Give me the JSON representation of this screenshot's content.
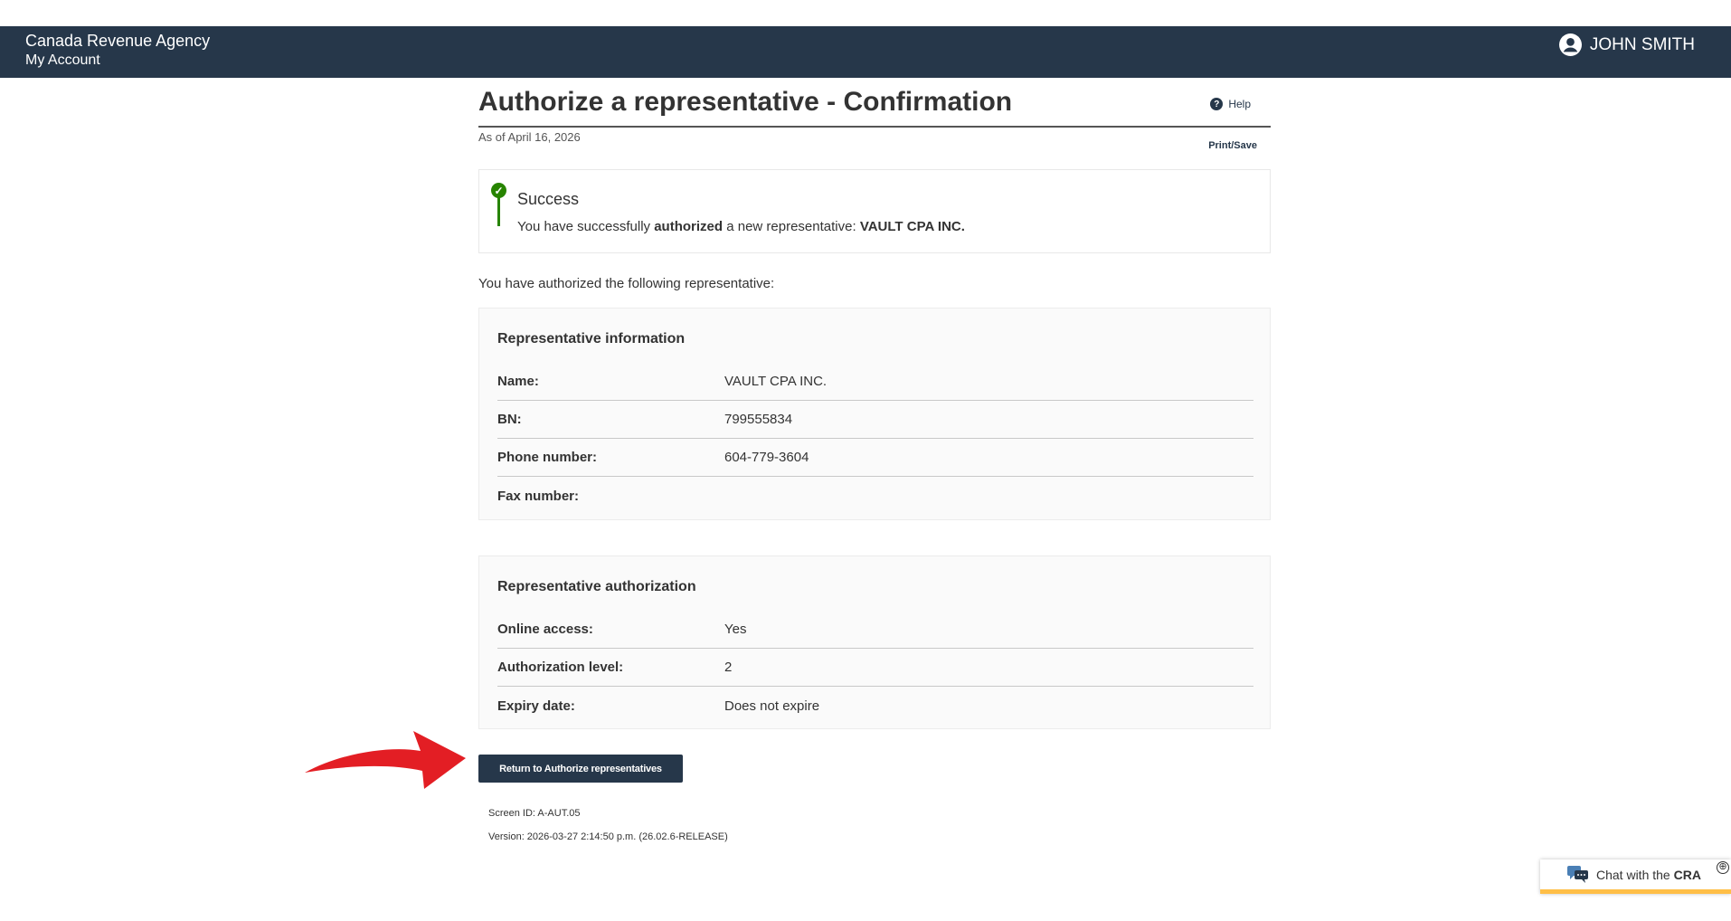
{
  "header": {
    "agency": "Canada Revenue Agency",
    "account_link": "My Account",
    "user_name": "JOHN SMITH"
  },
  "page": {
    "title": "Authorize a representative - Confirmation",
    "help": "Help",
    "as_of": "As of April 16, 2026",
    "print_save": "Print/Save"
  },
  "alert": {
    "heading": "Success",
    "msg_prefix": "You have successfully ",
    "msg_bold1": "authorized",
    "msg_middle": " a new representative: ",
    "msg_bold2": "VAULT CPA INC."
  },
  "intro": "You have authorized the following representative:",
  "representative_info": {
    "title": "Representative information",
    "rows": [
      {
        "label": "Name:",
        "value": "VAULT CPA INC."
      },
      {
        "label": "BN:",
        "value": "799555834"
      },
      {
        "label": "Phone number:",
        "value": "604-779-3604"
      },
      {
        "label": "Fax number:",
        "value": ""
      }
    ]
  },
  "representative_auth": {
    "title": "Representative authorization",
    "rows": [
      {
        "label": "Online access:",
        "value": "Yes"
      },
      {
        "label": "Authorization level:",
        "value": "2"
      },
      {
        "label": "Expiry date:",
        "value": "Does not expire"
      }
    ]
  },
  "return_button": "Return to Authorize representatives",
  "footer": {
    "screen_id": "Screen ID: A-AUT.05",
    "version": "Version: 2026-03-27 2:14:50 p.m. (26.02.6-RELEASE)"
  },
  "chat": {
    "prefix": "Chat with the ",
    "bold": "CRA",
    "expand_symbol": "⊕"
  },
  "colors": {
    "header_bg": "#26374a",
    "success_green": "#278400",
    "chat_accent": "#ffbf47",
    "annotation_arrow": "#e31e24"
  },
  "icons": {
    "user": "user-circle-icon",
    "help": "question-circle-icon",
    "success": "check-circle-icon",
    "chat": "chat-bubbles-icon",
    "arrow": "red-arrow-annotation"
  }
}
